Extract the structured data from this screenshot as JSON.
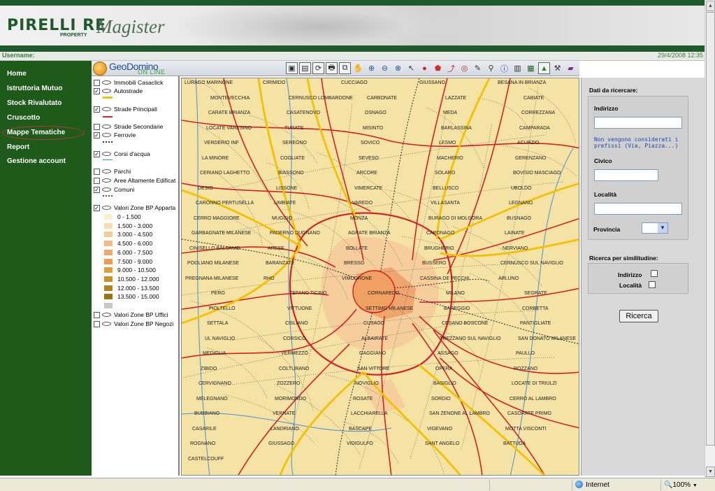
{
  "header": {
    "logo": "PIRELLI RE",
    "logo_sub": "PROPERTY",
    "app_title": "Magister"
  },
  "userbar": {
    "username_label": "Username:",
    "datetime": "29/4/2008 12:35"
  },
  "nav": {
    "items": [
      {
        "label": "Home"
      },
      {
        "label": "Istruttoria Mutuo"
      },
      {
        "label": "Stock Rivalutato"
      },
      {
        "label": "Cruscotto"
      },
      {
        "label": "Mappe Tematiche"
      },
      {
        "label": "Report"
      },
      {
        "label": "Gestione account"
      }
    ],
    "selected": "Mappe Tematiche"
  },
  "geodomino": {
    "name": "GeoDomino",
    "sub": "ON LINE"
  },
  "toolbar": {
    "tools": [
      "map-icon",
      "layers-icon",
      "refresh-icon",
      "print-icon",
      "copy-icon",
      "pan-icon",
      "zoom-in-icon",
      "zoom-out-icon",
      "zoom-extent-icon",
      "select-arrow-icon",
      "circle-icon",
      "polygon-icon",
      "route-icon",
      "buffer-icon",
      "eraser-icon",
      "binoculars-icon",
      "info-icon",
      "ruler-icon",
      "legend-icon",
      "triangle-icon",
      "tools-icon",
      "book-icon"
    ]
  },
  "layers": {
    "items": [
      {
        "label": "Immobili Casaclick",
        "checked": false
      },
      {
        "label": "Autostrade",
        "checked": true
      },
      {
        "label": "Strade Principali",
        "checked": true
      },
      {
        "label": "Strade Secondarie",
        "checked": false
      },
      {
        "label": "Ferrovie",
        "checked": true
      },
      {
        "label": "Corsi d'acqua",
        "checked": true
      },
      {
        "label": "Parchi",
        "checked": false
      },
      {
        "label": "Aree Altamente Edificat",
        "checked": false
      },
      {
        "label": "Comuni",
        "checked": true
      },
      {
        "label": "Valori Zone BP Apparta",
        "checked": true
      },
      {
        "label": "Valori Zone BP Uffici",
        "checked": false
      },
      {
        "label": "Valori Zone BP Negozi",
        "checked": false
      }
    ],
    "legend": [
      {
        "label": "0 - 1.500",
        "color": "#fbf0c8"
      },
      {
        "label": "1.500 - 3.000",
        "color": "#fbdcae"
      },
      {
        "label": "3.000 - 4.500",
        "color": "#f8c99a"
      },
      {
        "label": "4.500 - 6.000",
        "color": "#f6b887"
      },
      {
        "label": "6.000 - 7.500",
        "color": "#f3a56a"
      },
      {
        "label": "7.500 - 9.000",
        "color": "#ef9a50"
      },
      {
        "label": "9.000 - 10.500",
        "color": "#e0a03c"
      },
      {
        "label": "10.500 - 12.000",
        "color": "#c89420"
      },
      {
        "label": "12.000 - 13.500",
        "color": "#b08418"
      },
      {
        "label": "13.500 - 15.000",
        "color": "#9a7414"
      },
      {
        "label": "",
        "color": "#c8c8c8"
      }
    ]
  },
  "map": {
    "labels": [
      "LURAGO MARINONE",
      "CIRIMIDO",
      "CUCCIAGO",
      "GIUSSANO",
      "BESANA IN BRIANZA",
      "MONTEVECCHIA",
      "CERNUSCO LOMBARDONE",
      "CARBONATE",
      "LAZZATE",
      "CABIATE",
      "CARATE BRIANZA",
      "CASATENOVO",
      "OSNAGO",
      "MEDA",
      "CORREZZANA",
      "LOCATE VARESINO",
      "TURATE",
      "MISINTO",
      "BARLASSINA",
      "CAMPARADA",
      "VERDERIO INF",
      "SEREGNO",
      "SOVICO",
      "LESMO",
      "ACURZIO",
      "LA MINORE",
      "COGLIATE",
      "SEVESO",
      "MACHERIO",
      "GERENZANO",
      "CERIANO LAGHETTO",
      "BIASSONO",
      "ARCORE",
      "SOLARO",
      "BOVISIO MASCIAGO",
      "DESIO",
      "LISSONE",
      "VIMERCATE",
      "BELLUSCO",
      "UBOLDO",
      "CARONNO PERTUSELLA",
      "LIMBIATE",
      "VAREDO",
      "VILLASANTA",
      "LEGNANO",
      "CERRO MAGGIORE",
      "MUGGIO",
      "MONZA",
      "BURAGO DI MOLGORA",
      "BUSNAGO",
      "GARBAGNATE MILANESE",
      "PADERNO DUGNANO",
      "AGRATE BRIANZA",
      "CAPONAGO",
      "LAINATE",
      "CINISELLO BALSAMO",
      "ARESE",
      "BOLLATE",
      "BRUGHERIO",
      "NERVIANO",
      "POGLIANO MILANESE",
      "BARANZATE",
      "BRESSO",
      "BUSSERO",
      "CERNUSCO SUL NAVIGLIO",
      "PREGNANA MILANESE",
      "RHO",
      "VIMODRONE",
      "CASSINA DE PECCHI",
      "ARLUNO",
      "PERO",
      "TEFANO TICINO",
      "CORNAREDO",
      "MILANO",
      "SEGRATE",
      "PIOLTELLO",
      "VITTUONE",
      "SETTIMO MILANESE",
      "BAREGGIO",
      "CORBETTA",
      "SETTALA",
      "CISLIANO",
      "CUSAGO",
      "CESANO BOSCONE",
      "PANTIGLIATE",
      "UL NAVIGLIO",
      "CORSICO",
      "ALBAIRATE",
      "TREZZANO SUL NAVIGLIO",
      "SAN DONATO MILANESE",
      "MEDIGLIA",
      "VERMEZZO",
      "GAGGIANO",
      "ASSAGO",
      "PAULLO",
      "ZIBIDO",
      "COLTURANO",
      "SAN VITTORE",
      "OPERA",
      "ROZZANO",
      "CERVIGNANO",
      "ZOZZERO",
      "NOVIGLIO",
      "BASIGLIO",
      "LOCATE DI TRIULZI",
      "MELEGNANO",
      "MORIMONDO",
      "ROSATE",
      "SORDIO",
      "CERRO AL LAMBRO",
      "BUBBIANO",
      "VERNATE",
      "LACCHIARELLA",
      "SAN ZENONE AL LAMBRO",
      "CASORATE PRIMO",
      "CASARILE",
      "LANDRIANO",
      "BASCAPE",
      "VIGEVANO",
      "MOTTA VISCONTI",
      "ROGNANO",
      "GIUSSAGO",
      "VIDIGULFO",
      "SANT ANGELO",
      "BATTUDA",
      "CASTELCOUFF"
    ]
  },
  "search": {
    "title": "Dati da ricercare:",
    "indirizzo_label": "Indirizzo",
    "indirizzo_value": "",
    "note": "Non vengono considerati i prefissi (Via, Piazza...)",
    "civico_label": "Civico",
    "civico_value": "",
    "localita_label": "Località",
    "localita_value": "",
    "provincia_label": "Provincia",
    "provincia_value": "",
    "similarity_title": "Ricerca per similitudine:",
    "sim_indirizzo_label": "Indirizzo",
    "sim_localita_label": "Località",
    "button_label": "Ricerca"
  },
  "statusbar": {
    "zone": "Internet",
    "zoom": "100%"
  }
}
